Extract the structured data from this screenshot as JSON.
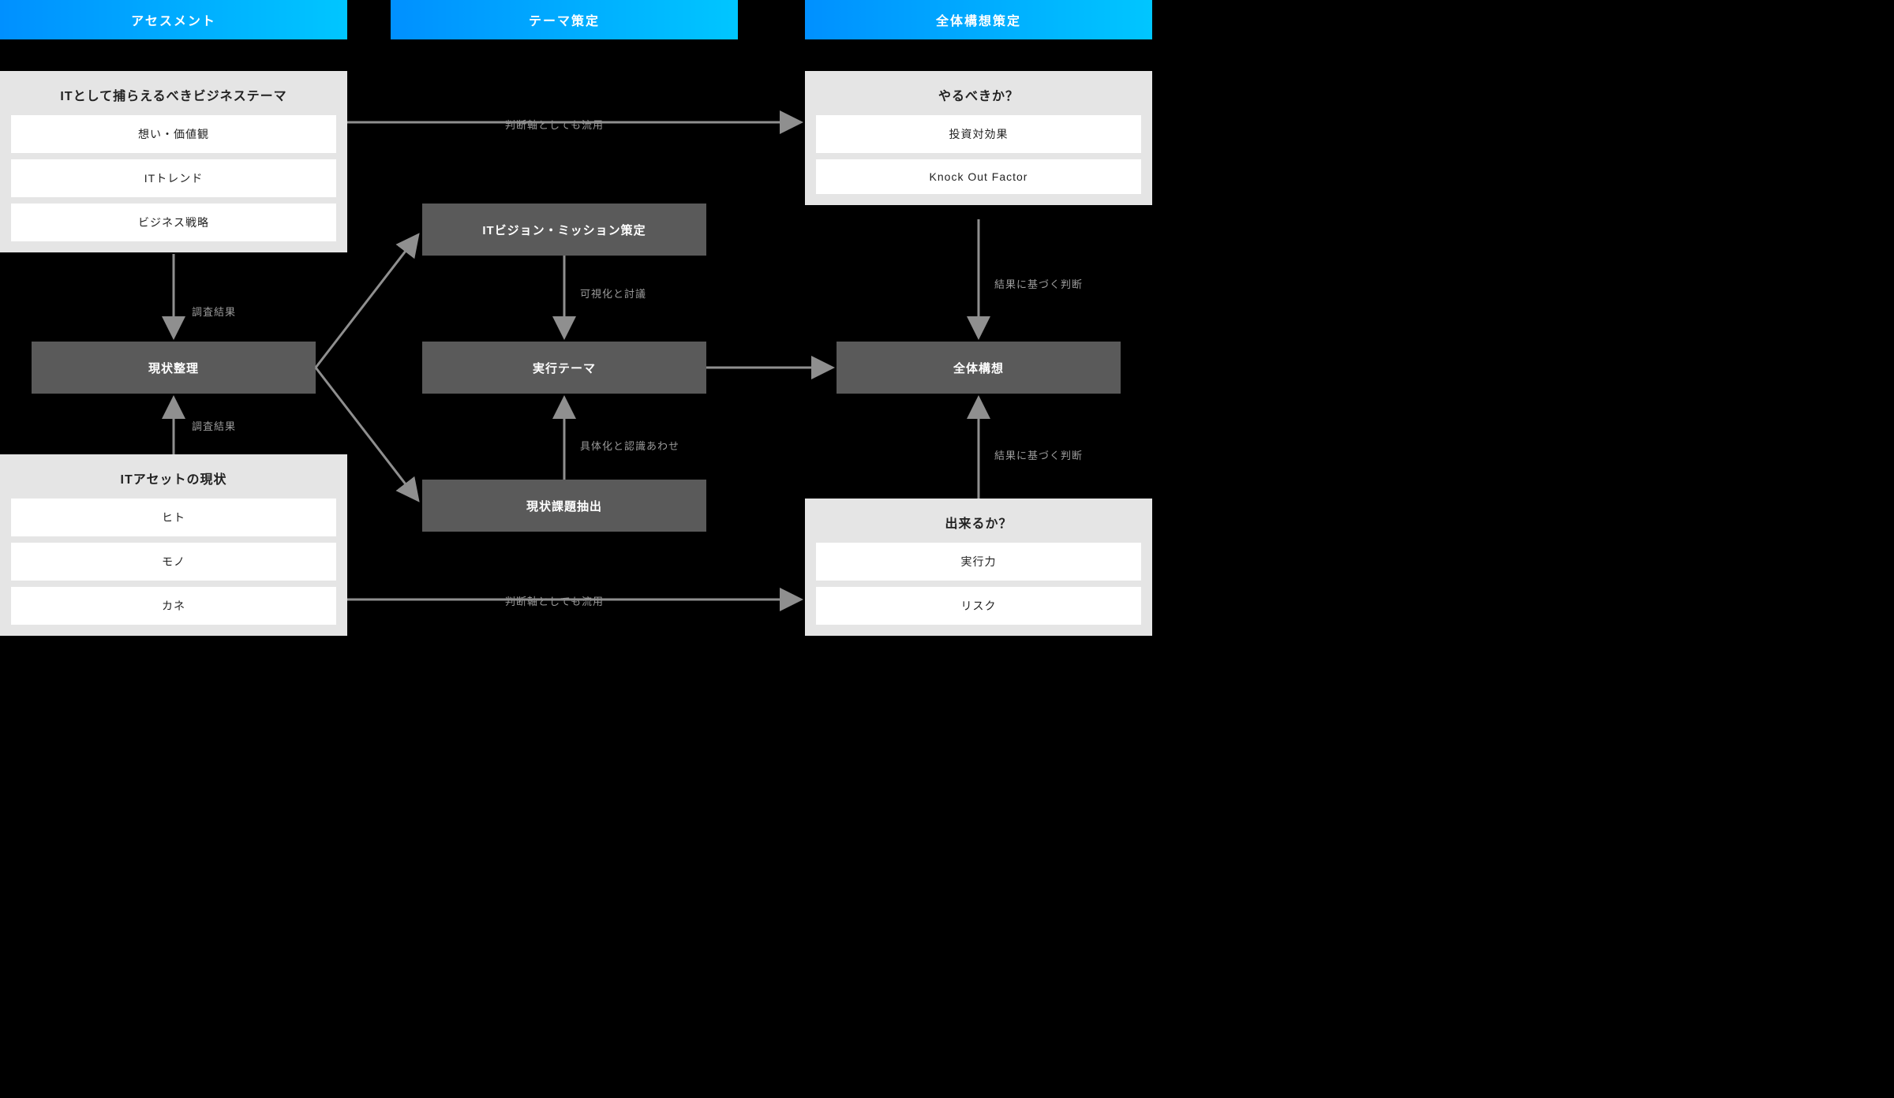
{
  "phases": {
    "assessment": "アセスメント",
    "theme": "テーマ策定",
    "concept": "全体構想策定"
  },
  "panels": {
    "business_theme": {
      "title": "ITとして捕らえるべきビジネステーマ",
      "items": [
        "想い・価値観",
        "ITトレンド",
        "ビジネス戦略"
      ]
    },
    "it_asset": {
      "title": "ITアセットの現状",
      "items": [
        "ヒト",
        "モノ",
        "カネ"
      ]
    },
    "should_do": {
      "title": "やるべきか？",
      "items": [
        "投資対効果",
        "Knock Out Factor"
      ]
    },
    "can_do": {
      "title": "出来るか？",
      "items": [
        "実行力",
        "リスク"
      ]
    }
  },
  "boxes": {
    "current_status": "現状整理",
    "vision_mission": "ITビジョン・ミッション策定",
    "exec_theme": "実行テーマ",
    "issue_extract": "現状課題抽出",
    "overall_concept": "全体構想"
  },
  "labels": {
    "survey_result_top": "調査結果",
    "survey_result_bottom": "調査結果",
    "also_as_criteria_top": "判断軸としても流用",
    "also_as_criteria_bottom": "判断軸としても流用",
    "visualize_discuss": "可視化と討議",
    "concretize_align": "具体化と認識あわせ",
    "result_based_top": "結果に基づく判断",
    "result_based_bottom": "結果に基づく判断"
  },
  "colors": {
    "phase_gradient_start": "#0090ff",
    "phase_gradient_end": "#00c6ff",
    "panel_bg": "#e5e5e5",
    "box_bg": "#5a5a5a",
    "arrow": "#8f8f8f"
  }
}
